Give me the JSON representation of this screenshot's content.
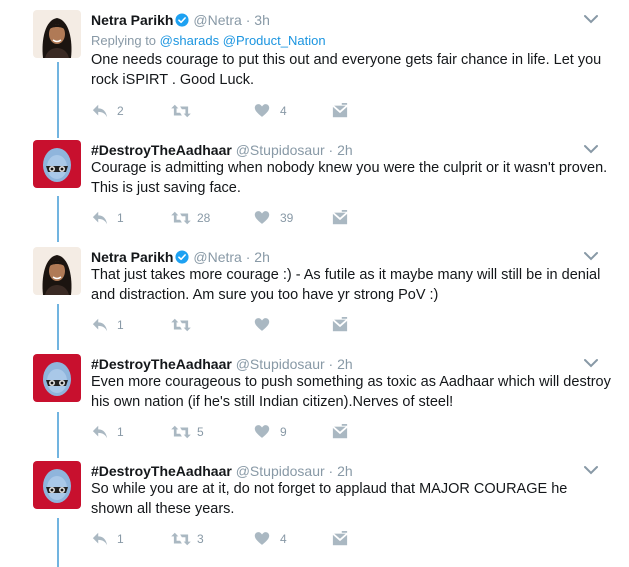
{
  "tweets": [
    {
      "name": "Netra Parikh",
      "handle": "@Netra",
      "time": "3h",
      "verified": true,
      "replying_label": "Replying to",
      "replying_to": [
        "@sharads",
        "@Product_Nation"
      ],
      "text": "One needs courage to put this out and everyone gets fair chance in life. Let you rock iSPIRT . Good Luck.",
      "replies": "2",
      "retweets": "",
      "likes": "4"
    },
    {
      "name": "#DestroyTheAadhaar",
      "handle": "@Stupidosaur",
      "time": "2h",
      "verified": false,
      "text": "Courage is admitting when nobody knew you were the culprit or it wasn't proven. This is just saving face.",
      "replies": "1",
      "retweets": "28",
      "likes": "39"
    },
    {
      "name": "Netra Parikh",
      "handle": "@Netra",
      "time": "2h",
      "verified": true,
      "text": "That just takes more courage :) -  As futile as it maybe many will still be in denial and distraction. Am sure you too have yr strong PoV :)",
      "replies": "1",
      "retweets": "",
      "likes": ""
    },
    {
      "name": "#DestroyTheAadhaar",
      "handle": "@Stupidosaur",
      "time": "2h",
      "verified": false,
      "text": "Even more courageous to push something as toxic as Aadhaar which will destroy his own nation (if he's still Indian citizen).Nerves of steel!",
      "replies": "1",
      "retweets": "5",
      "likes": "9"
    },
    {
      "name": "#DestroyTheAadhaar",
      "handle": "@Stupidosaur",
      "time": "2h",
      "verified": false,
      "text": "So while you are at it, do not forget to applaud that MAJOR COURAGE he shown all these years.",
      "replies": "1",
      "retweets": "3",
      "likes": "4"
    }
  ],
  "separator": "·",
  "icons": {
    "reply": "reply-icon",
    "retweet": "retweet-icon",
    "like": "heart-icon",
    "dm": "direct-message-icon",
    "caret": "chevron-down-icon",
    "verified": "verified-badge-icon"
  },
  "colors": {
    "thread_line": "#71b4e0",
    "link": "#1b95e0",
    "muted": "#8899a6",
    "icon": "#aab8c2",
    "verified": "#1da1f2",
    "avatar_red": "#c8102e"
  }
}
